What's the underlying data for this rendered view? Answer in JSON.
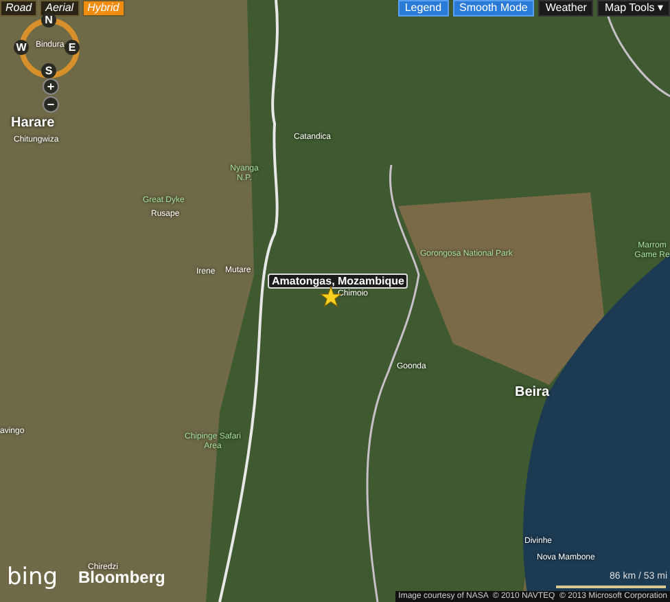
{
  "map_type_tabs": [
    {
      "label": "Road",
      "selected": false
    },
    {
      "label": "Aerial",
      "selected": false
    },
    {
      "label": "Hybrid",
      "selected": true
    }
  ],
  "toolbar_right": [
    {
      "label": "Legend",
      "on": true
    },
    {
      "label": "Smooth Mode",
      "on": true
    },
    {
      "label": "Weather",
      "on": false
    },
    {
      "label": "Map Tools ▾",
      "on": false
    }
  ],
  "compass": {
    "north": "N",
    "east": "E",
    "south": "S",
    "west": "W"
  },
  "zoom_controls": [
    "+",
    "−"
  ],
  "map_labels": [
    {
      "label": "Bindura",
      "kind": "town"
    },
    {
      "label": "Harare",
      "kind": "city"
    },
    {
      "label": "Chitungwiza",
      "kind": "town"
    },
    {
      "label": "Catandica",
      "kind": "town"
    },
    {
      "label": "Nyanga N.P.",
      "kind": "park"
    },
    {
      "label": "Great Dyke",
      "kind": "park"
    },
    {
      "label": "Rusape",
      "kind": "town"
    },
    {
      "label": "Irene",
      "kind": "town"
    },
    {
      "label": "Mutare",
      "kind": "town"
    },
    {
      "label": "Chimoio",
      "kind": "town"
    },
    {
      "label": "Gorongosa National Park",
      "kind": "park"
    },
    {
      "label": "Marrom Game Re",
      "kind": "park"
    },
    {
      "label": "Goonda",
      "kind": "town"
    },
    {
      "label": "Beira",
      "kind": "city"
    },
    {
      "label": "avingo",
      "kind": "town"
    },
    {
      "label": "Chipinge Safari Area",
      "kind": "park"
    },
    {
      "label": "Divinhe",
      "kind": "town"
    },
    {
      "label": "Nova Mambone",
      "kind": "town"
    },
    {
      "label": "Chiredzi",
      "kind": "town"
    }
  ],
  "pushpin": {
    "label": "Amatongas, Mozambique"
  },
  "logos": {
    "bing": "bing",
    "partner": "Bloomberg"
  },
  "scale": {
    "label": "86 km / 53 mi"
  },
  "copyright": "Image courtesy of NASA  © 2010 NAVTEQ  © 2013 Microsoft Corporation"
}
